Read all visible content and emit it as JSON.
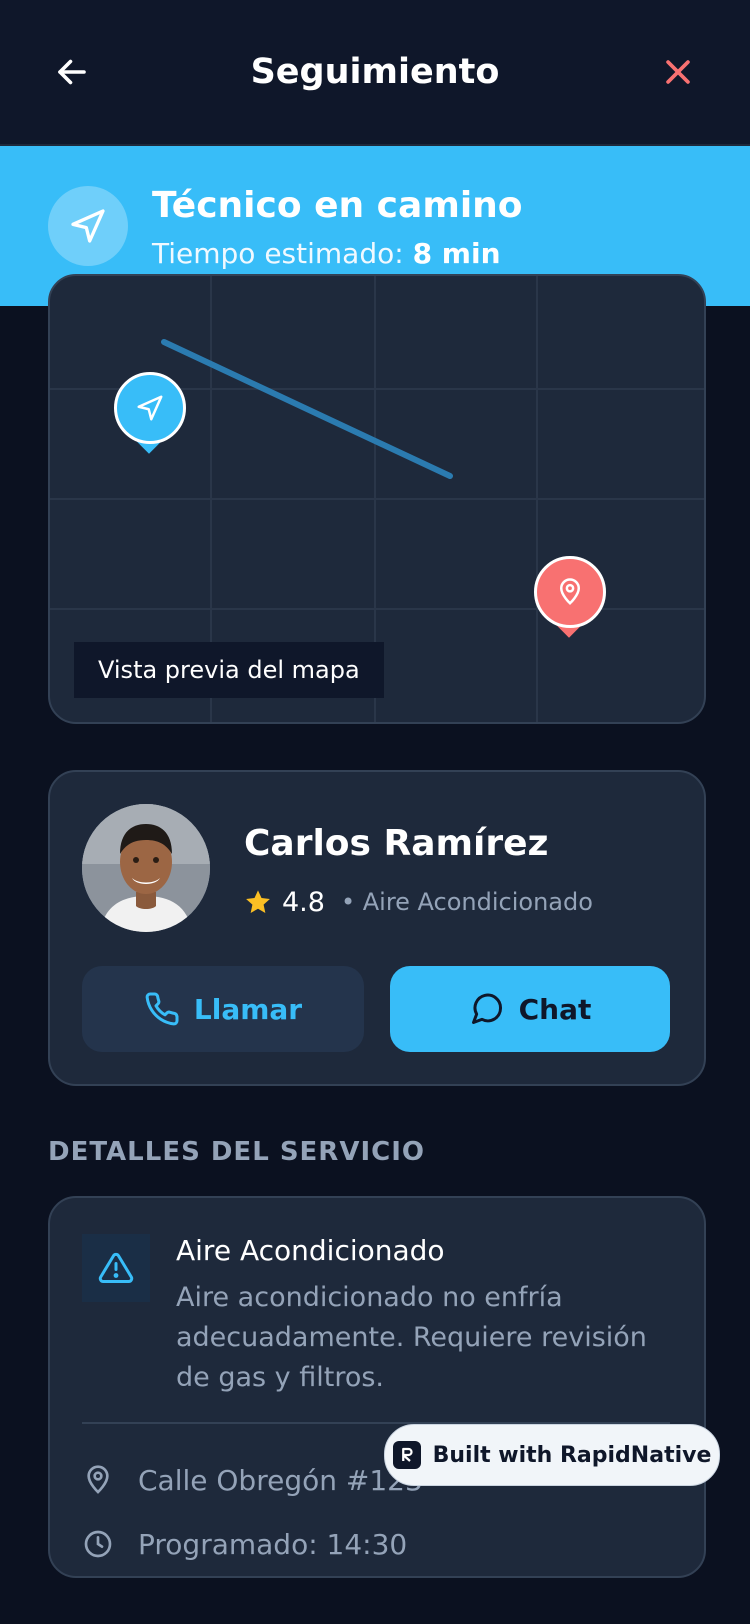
{
  "header": {
    "title": "Seguimiento"
  },
  "banner": {
    "title": "Técnico en camino",
    "eta_prefix": "Tiempo estimado: ",
    "eta_value": "8 min"
  },
  "map": {
    "label": "Vista previa del mapa"
  },
  "technician": {
    "name": "Carlos Ramírez",
    "rating": "4.8",
    "specialty": "• Aire Acondicionado",
    "call_label": "Llamar",
    "chat_label": "Chat"
  },
  "details": {
    "section_title": "DETALLES DEL SERVICIO",
    "service_name": "Aire Acondicionado",
    "description": "Aire acondicionado no enfría adecuadamente. Requiere revisión de gas y filtros.",
    "address": "Calle Obregón #123",
    "schedule": "Programado: 14:30"
  },
  "badge": {
    "label": "Built with RapidNative"
  },
  "colors": {
    "accent": "#38bdf8",
    "destination": "#f87171",
    "background": "#0b1120",
    "card": "#1e293b",
    "star": "#fbbf24"
  }
}
